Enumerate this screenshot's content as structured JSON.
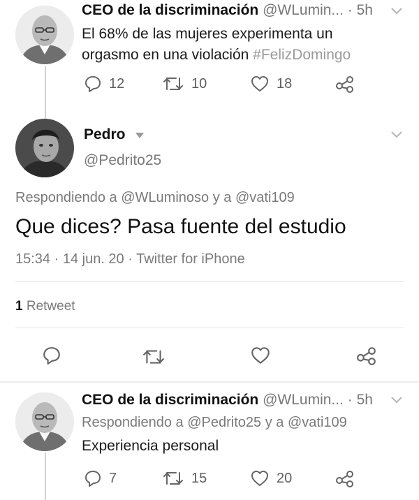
{
  "tweet1": {
    "display_name": "CEO de la discriminación",
    "handle": "@WLumin...",
    "time": "· 5h",
    "text_main": "El 68% de las mujeres experimenta un orgasmo en una violación",
    "hashtag": "#FelizDomingo",
    "replies": "12",
    "retweets": "10",
    "likes": "18"
  },
  "main_tweet": {
    "display_name": "Pedro",
    "handle": "@Pedrito25",
    "replying_prefix": "Respondiendo a",
    "replying_to_1": "@WLuminoso",
    "replying_join": "y a",
    "replying_to_2": "@vati109",
    "text": "Que dices? Pasa fuente del estudio",
    "meta": "15:34 · 14 jun. 20 · Twitter for iPhone",
    "retweet_count": "1",
    "retweet_label": "Retweet"
  },
  "tweet3": {
    "display_name": "CEO de la discriminación",
    "handle": "@WLumin...",
    "time": "· 5h",
    "replying_prefix": "Respondiendo a",
    "replying_to_1": "@Pedrito25",
    "replying_join": "y a",
    "replying_to_2": "@vati109",
    "text": "Experiencia personal",
    "replies": "7",
    "retweets": "15",
    "likes": "20"
  },
  "icons": {
    "reply": "reply-icon",
    "retweet": "retweet-icon",
    "like": "heart-icon",
    "share": "share-icon",
    "chevron": "chevron-down-icon",
    "caret": "dropdown-caret-icon"
  }
}
